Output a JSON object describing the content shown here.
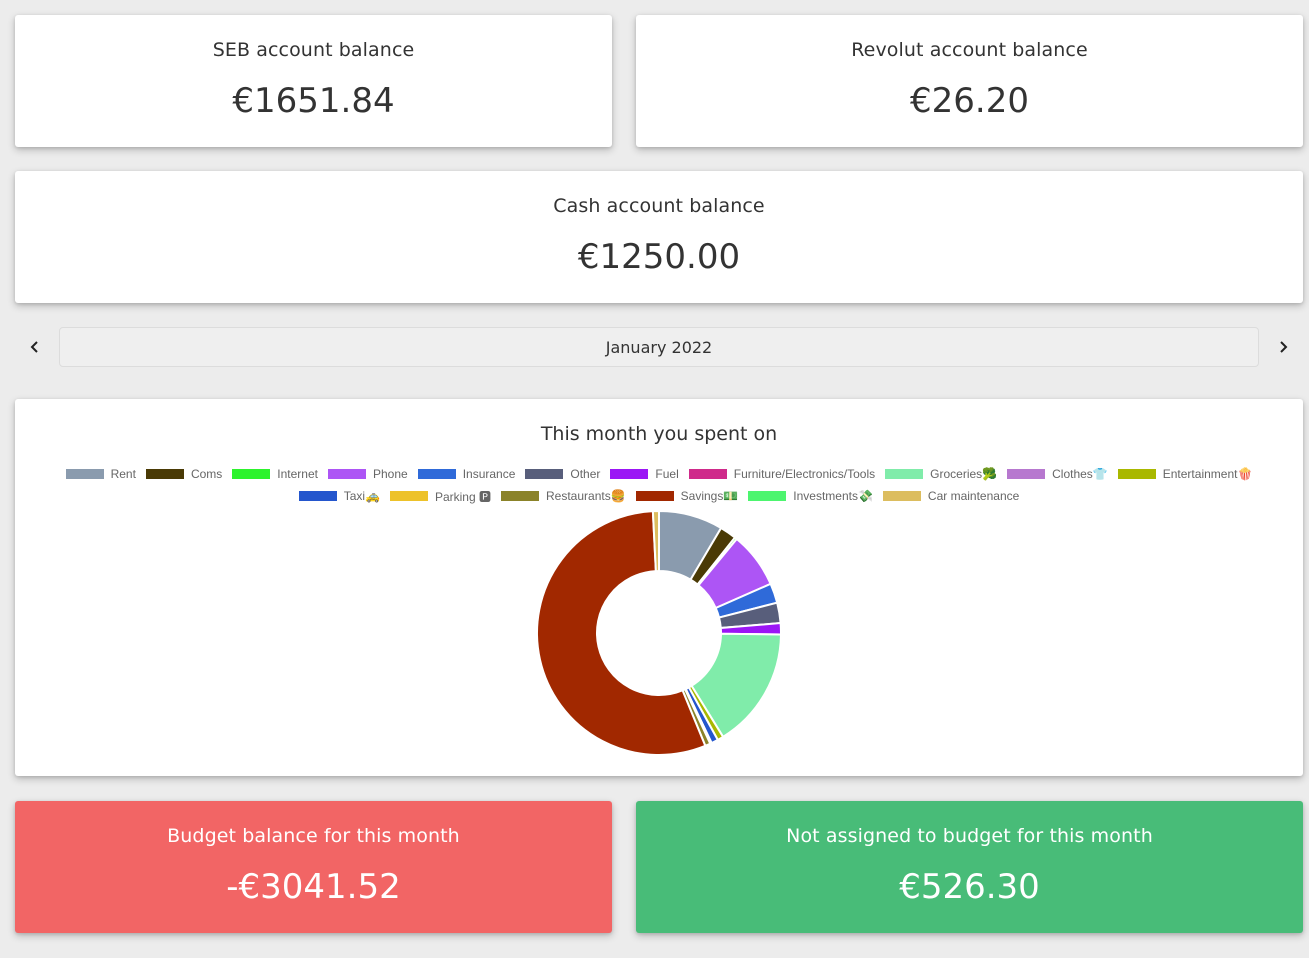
{
  "accounts": {
    "seb": {
      "title": "SEB account balance",
      "value": "€1651.84"
    },
    "revolut": {
      "title": "Revolut account balance",
      "value": "€26.20"
    },
    "cash": {
      "title": "Cash account balance",
      "value": "€1250.00"
    }
  },
  "month_nav": {
    "label": "January 2022",
    "prev_icon": "chevron-left-icon",
    "next_icon": "chevron-right-icon"
  },
  "summary": {
    "budget": {
      "title": "Budget balance for this month",
      "value": "-€3041.52",
      "color": "#f26565"
    },
    "unassigned": {
      "title": "Not assigned to budget for this month",
      "value": "€526.30",
      "color": "#48bc78"
    }
  },
  "chart_data": {
    "type": "pie",
    "title": "This month you spent on",
    "legend_position": "top",
    "categories": [
      "Rent",
      "Coms",
      "Internet",
      "Phone",
      "Insurance",
      "Other",
      "Fuel",
      "Furniture/Electronics/Tools",
      "Groceries🥦",
      "Clothes👕",
      "Entertainment🍿",
      "Taxi🚕",
      "Parking 🅿",
      "Restaurants🍔",
      "Savings💵",
      "Investments💸",
      "Car maintenance"
    ],
    "colors": [
      "#8a9bae",
      "#4a3a05",
      "#2df32d",
      "#ad55f5",
      "#2f6ad9",
      "#585e7b",
      "#9b16f5",
      "#cf2a8a",
      "#80ecaa",
      "#b778cf",
      "#a9b800",
      "#2456cd",
      "#edc22a",
      "#8b8329",
      "#a12800",
      "#4df56f",
      "#dcbd5f"
    ],
    "values": [
      8.5,
      2.2,
      0.3,
      7.4,
      2.6,
      2.7,
      1.5,
      0.0,
      16.0,
      0.0,
      0.8,
      0.9,
      0.2,
      0.7,
      55.4,
      0.0,
      0.8
    ]
  }
}
